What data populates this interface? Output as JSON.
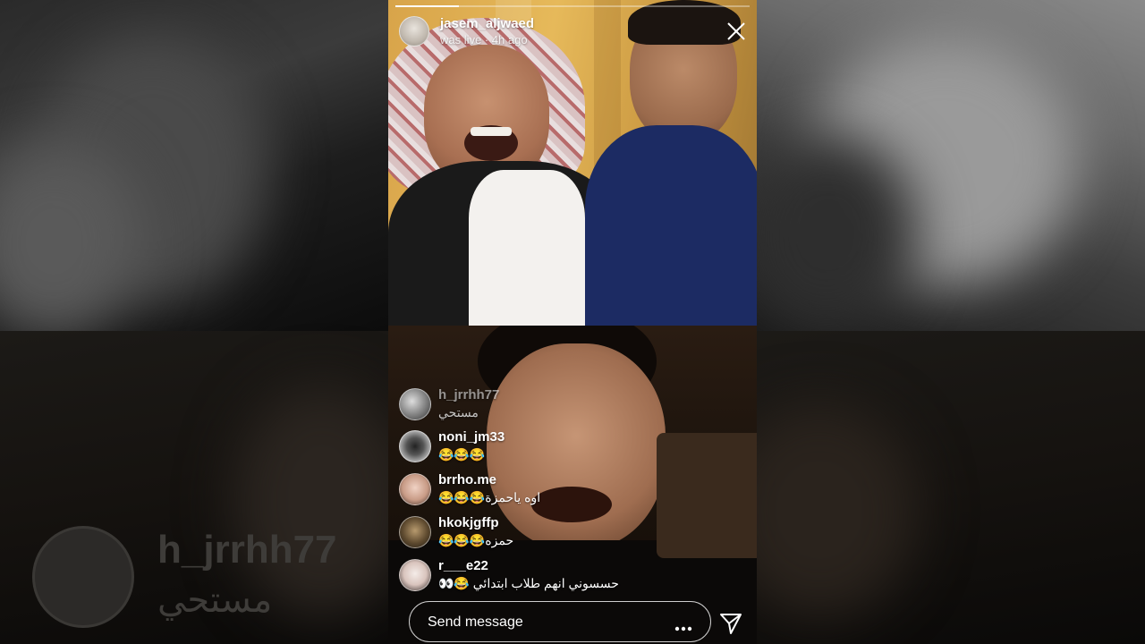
{
  "header": {
    "username": "jasem_aljwaed",
    "status": "was live · 4h ago",
    "close_icon": "close-icon",
    "progress_fraction": 0.18
  },
  "comments": [
    {
      "username": "h_jrrhh77",
      "text": "مستحي",
      "faded": true
    },
    {
      "username": "noni_jm33",
      "text": "😂😂😂",
      "faded": false
    },
    {
      "username": "brrho.me",
      "text": "اوه ياحمزة😂😂😂",
      "faded": false
    },
    {
      "username": "hkokjgffp",
      "text": "حمزه😂😂😂",
      "faded": false
    },
    {
      "username": "r___e22",
      "text": "حسسوني انهم طلاب ابتدائي 😂👀",
      "faded": false
    }
  ],
  "backdrop_comment": {
    "username": "h_jrrhh77",
    "text": "مستحي"
  },
  "composer": {
    "placeholder": "Send message",
    "more_icon": "more-horizontal-icon",
    "send_icon": "send-icon"
  },
  "colors": {
    "top_video_accent": "#e6b95a",
    "bottom_video_accent": "#1d140d",
    "text": "#ffffff"
  }
}
